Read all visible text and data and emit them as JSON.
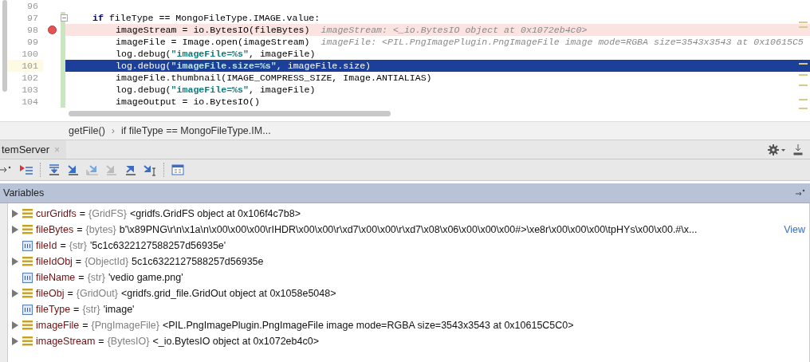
{
  "editor": {
    "lines": [
      {
        "number": "96"
      },
      {
        "number": "97",
        "foldable": true,
        "segments": [
          {
            "kind": "keyword",
            "text": "if"
          },
          {
            "kind": "text",
            "text": " fileType == MongoFileType.IMAGE.value:"
          }
        ],
        "children": [
          {
            "number": "98",
            "breakpoint": true,
            "selected": false,
            "segments": [
              {
                "kind": "text",
                "text": "imageStream = io.BytesIO(fileBytes)"
              }
            ],
            "hint": "imageStream: <_io.BytesIO object at 0x1072eb4c0>"
          },
          {
            "number": "99",
            "breakpoint": false,
            "selected": false,
            "segments": [
              {
                "kind": "text",
                "text": "imageFile = Image.open(imageStream)"
              }
            ],
            "hint": "imageFile: <PIL.PngImagePlugin.PngImageFile image mode=RGBA size=3543x3543 at 0x10615C5"
          },
          {
            "number": "100",
            "breakpoint": false,
            "selected": false,
            "segments": [
              {
                "kind": "text",
                "text": "log.debug("
              },
              {
                "kind": "string",
                "text": "\"imageFile=%s\""
              },
              {
                "kind": "text",
                "text": ", imageFile)"
              }
            ]
          },
          {
            "number": "101",
            "breakpoint": false,
            "selected": true,
            "segments": [
              {
                "kind": "text",
                "text": "log.debug("
              },
              {
                "kind": "string",
                "text": "\"imageFile.size=%s\""
              },
              {
                "kind": "text",
                "text": ", imageFile.size)"
              }
            ]
          },
          {
            "number": "102",
            "breakpoint": false,
            "selected": false,
            "segments": [
              {
                "kind": "text",
                "text": "imageFile.thumbnail(IMAGE_COMPRESS_SIZE, Image.ANTIALIAS)"
              }
            ]
          },
          {
            "number": "103",
            "breakpoint": false,
            "selected": false,
            "segments": [
              {
                "kind": "text",
                "text": "log.debug("
              },
              {
                "kind": "string",
                "text": "\"imageFile=%s\""
              },
              {
                "kind": "text",
                "text": ", imageFile)"
              }
            ]
          },
          {
            "number": "104",
            "breakpoint": false,
            "selected": false,
            "segments": [
              {
                "kind": "text",
                "text": "imageOutput = io.BytesIO()"
              }
            ]
          }
        ]
      }
    ]
  },
  "breadcrumb": [
    {
      "label": "getFile()"
    },
    {
      "label": "if fileType == MongoFileType.IM..."
    }
  ],
  "breadcrumb_separator": "›",
  "debug_tab": {
    "label": "temServer",
    "close": "×"
  },
  "variables": {
    "title": "Variables",
    "items": [
      {
        "kind": "object",
        "name": "curGridfs",
        "operator": "=",
        "type": "{GridFS}",
        "value": "<gridfs.GridFS object at 0x106f4c7b8>"
      },
      {
        "kind": "object",
        "name": "fileBytes",
        "operator": "=",
        "type": "{bytes}",
        "value": "b'\\x89PNG\\r\\n\\x1a\\n\\x00\\x00\\x00\\rIHDR\\x00\\x00\\r\\xd7\\x00\\x00\\r\\xd7\\x08\\x06\\x00\\x00\\x00#>\\xe8r\\x00\\x00\\x00\\tpHYs\\x00\\x00.#\\x...",
        "link": "View"
      },
      {
        "kind": "string",
        "name": "fileId",
        "operator": "=",
        "type": "{str}",
        "value": "'5c1c6322127588257d56935e'"
      },
      {
        "kind": "object",
        "name": "fileIdObj",
        "operator": "=",
        "type": "{ObjectId}",
        "value": "5c1c6322127588257d56935e"
      },
      {
        "kind": "string",
        "name": "fileName",
        "operator": "=",
        "type": "{str}",
        "value": "'vedio game.png'"
      },
      {
        "kind": "object",
        "name": "fileObj",
        "operator": "=",
        "type": "{GridOut}",
        "value": "<gridfs.grid_file.GridOut object at 0x1058e5048>"
      },
      {
        "kind": "string",
        "name": "fileType",
        "operator": "=",
        "type": "{str}",
        "value": "'image'"
      },
      {
        "kind": "object",
        "name": "imageFile",
        "operator": "=",
        "type": "{PngImageFile}",
        "value": "<PIL.PngImagePlugin.PngImageFile image mode=RGBA size=3543x3543 at 0x10615C5C0>"
      },
      {
        "kind": "object",
        "name": "imageStream",
        "operator": "=",
        "type": "{BytesIO}",
        "value": "<_io.BytesIO object at 0x1072eb4c0>"
      }
    ]
  }
}
